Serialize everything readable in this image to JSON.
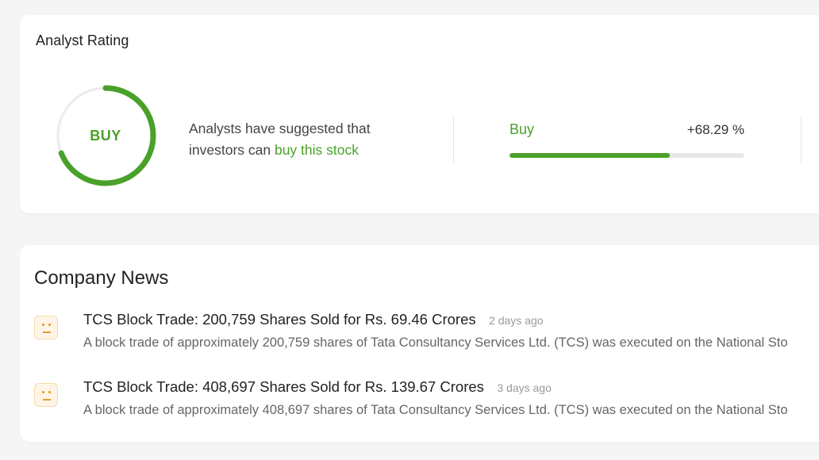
{
  "analyst_rating": {
    "title": "Analyst Rating",
    "gauge_label": "BUY",
    "gauge_fill_fraction": 0.69,
    "description_prefix": "Analysts have suggested that investors can ",
    "description_highlight": "buy this stock",
    "buy_label": "Buy",
    "buy_percent": "+68.29 %",
    "buy_fraction": 0.6829
  },
  "company_news": {
    "title": "Company News",
    "items": [
      {
        "icon": "neutral-face-icon",
        "headline": "TCS Block Trade: 200,759 Shares Sold for Rs. 69.46 Crores",
        "time": "2 days ago",
        "snippet": "A block trade of approximately 200,759 shares of Tata Consultancy Services Ltd. (TCS) was executed on the National Sto"
      },
      {
        "icon": "neutral-face-icon",
        "headline": "TCS Block Trade: 408,697 Shares Sold for Rs. 139.67 Crores",
        "time": "3 days ago",
        "snippet": "A block trade of approximately 408,697 shares of Tata Consultancy Services Ltd. (TCS) was executed on the National Sto"
      }
    ]
  },
  "colors": {
    "accent_green": "#4aa12a",
    "track_gray": "#e8e8e8",
    "neutral_orange": "#e89a2e"
  }
}
